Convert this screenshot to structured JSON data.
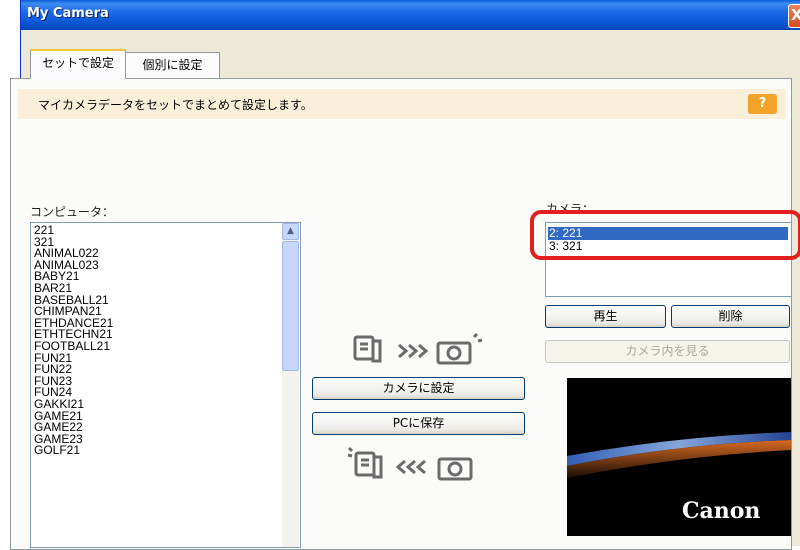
{
  "window": {
    "title": "My Camera",
    "close_label": "X"
  },
  "tabs": [
    {
      "label": "セットで設定"
    },
    {
      "label": "個別に設定"
    }
  ],
  "info": {
    "text": "マイカメラデータをセットでまとめて設定します。",
    "help_label": "?"
  },
  "computer": {
    "label": "コンピュータ：",
    "items": [
      "221",
      "321",
      "ANIMAL022",
      "ANIMAL023",
      "BABY21",
      "BAR21",
      "BASEBALL21",
      "CHIMPAN21",
      "ETHDANCE21",
      "ETHTECHN21",
      "FOOTBALL21",
      "FUN21",
      "FUN22",
      "FUN23",
      "FUN24",
      "GAKKI21",
      "GAME21",
      "GAME22",
      "GAME23",
      "GOLF21"
    ]
  },
  "camera": {
    "label": "カメラ：",
    "items": [
      "2: 221",
      "3: 321"
    ],
    "selected_index": 0,
    "play_label": "再生",
    "delete_label": "削除",
    "view_label": "カメラ内を見る",
    "brand": "Canon"
  },
  "transfer": {
    "set_to_camera_label": "カメラに設定",
    "save_to_pc_label": "PCに保存"
  },
  "colors": {
    "title_bar": "#0a53d1",
    "selection": "#316ac5",
    "highlight_box": "#e21e1e",
    "info_bg": "#fcefd9",
    "help_button": "#f3a22a"
  }
}
